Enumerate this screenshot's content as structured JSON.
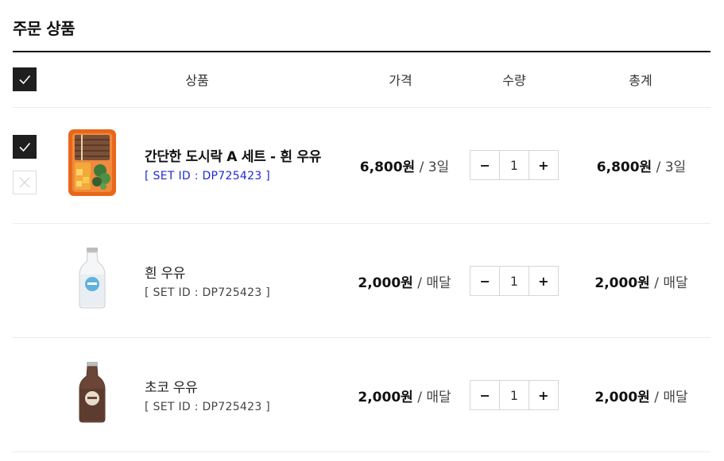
{
  "page": {
    "title": "주문 상품"
  },
  "header": {
    "select_all_checked": true,
    "columns": {
      "product": "상품",
      "price": "가격",
      "quantity": "수량",
      "total": "총계"
    }
  },
  "items": [
    {
      "name": "간단한 도시락 A 세트 - 흰 우유",
      "set_id": "[ SET ID : DP725423 ]",
      "image": "lunchbox-icon",
      "checked": true,
      "price_amount": "6,800원",
      "price_unit": " / 3일",
      "quantity": "1",
      "total_amount": "6,800원",
      "total_unit": " / 3일"
    },
    {
      "name": "흰 우유",
      "set_id": "[ SET ID : DP725423 ]",
      "image": "white-milk-bottle-icon",
      "price_amount": "2,000원",
      "price_unit": " / 매달",
      "quantity": "1",
      "total_amount": "2,000원",
      "total_unit": " / 매달"
    },
    {
      "name": "초코 우유",
      "set_id": "[ SET ID : DP725423 ]",
      "image": "chocolate-milk-bottle-icon",
      "price_amount": "2,000원",
      "price_unit": " / 매달",
      "quantity": "1",
      "total_amount": "2,000원",
      "total_unit": " / 매달"
    }
  ],
  "stepper": {
    "minus": "−",
    "plus": "+"
  },
  "colors": {
    "checkbox": "#1f1f1f",
    "set_id_link": "#1e2ad6",
    "divider": "#ececec",
    "title_rule": "#111111"
  }
}
